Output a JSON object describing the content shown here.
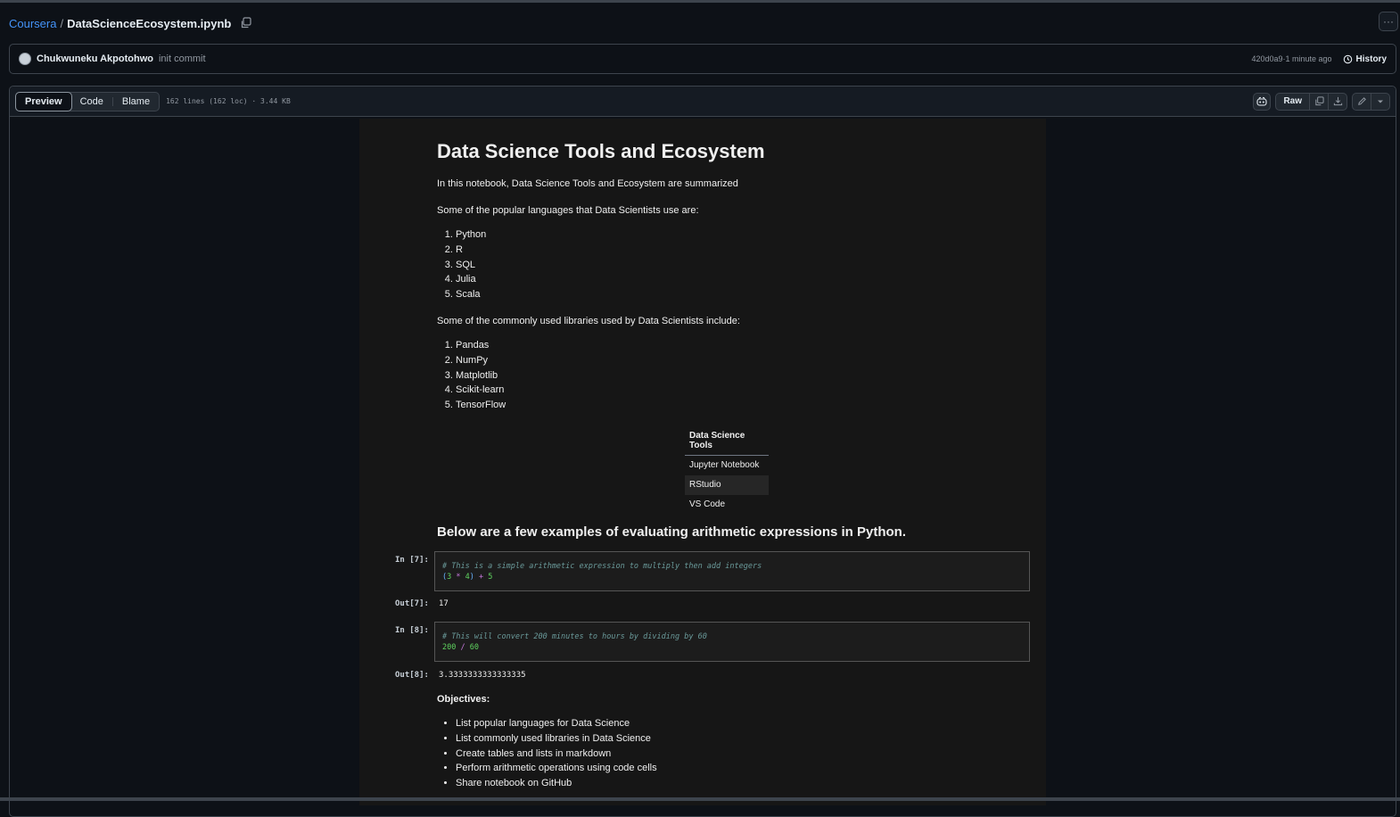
{
  "breadcrumb": {
    "repo": "Coursera",
    "separator": "/",
    "file": "DataScienceEcosystem.ipynb"
  },
  "commit": {
    "author": "Chukwuneku Akpotohwo",
    "message": "init commit",
    "hash": "420d0a9",
    "sep": " · ",
    "time": "1 minute ago",
    "history_label": "History"
  },
  "file_header": {
    "tabs": [
      "Preview",
      "Code",
      "Blame"
    ],
    "info": "162 lines (162 loc) · 3.44 KB",
    "raw_label": "Raw"
  },
  "notebook": {
    "title": "Data Science Tools and Ecosystem",
    "intro": "In this notebook, Data Science Tools and Ecosystem are summarized",
    "languages_intro": "Some of the popular languages that Data Scientists use are:",
    "languages": [
      "Python",
      "R",
      "SQL",
      "Julia",
      "Scala"
    ],
    "libraries_intro": "Some of the commonly used libraries used by Data Scientists include:",
    "libraries": [
      "Pandas",
      "NumPy",
      "Matplotlib",
      "Scikit-learn",
      "TensorFlow"
    ],
    "table": {
      "header": "Data Science Tools",
      "rows": [
        "Jupyter Notebook",
        "RStudio",
        "VS Code"
      ]
    },
    "arith_heading": "Below are a few examples of evaluating arithmetic expressions in Python.",
    "cells": [
      {
        "in_prompt": "In [7]:",
        "comment": "# This is a simple arithmetic expression to multiply then add integers",
        "out_prompt": "Out[7]:",
        "output": "17"
      },
      {
        "in_prompt": "In [8]:",
        "comment": "# This will convert 200 minutes to hours by dividing by 60",
        "out_prompt": "Out[8]:",
        "output": "3.3333333333333335"
      }
    ],
    "objectives_title": "Objectives:",
    "objectives": [
      "List popular languages for Data Science",
      "List commonly used libraries in Data Science",
      "Create tables and lists in markdown",
      "Perform arithmetic operations using code cells",
      "Share notebook on GitHub"
    ]
  }
}
